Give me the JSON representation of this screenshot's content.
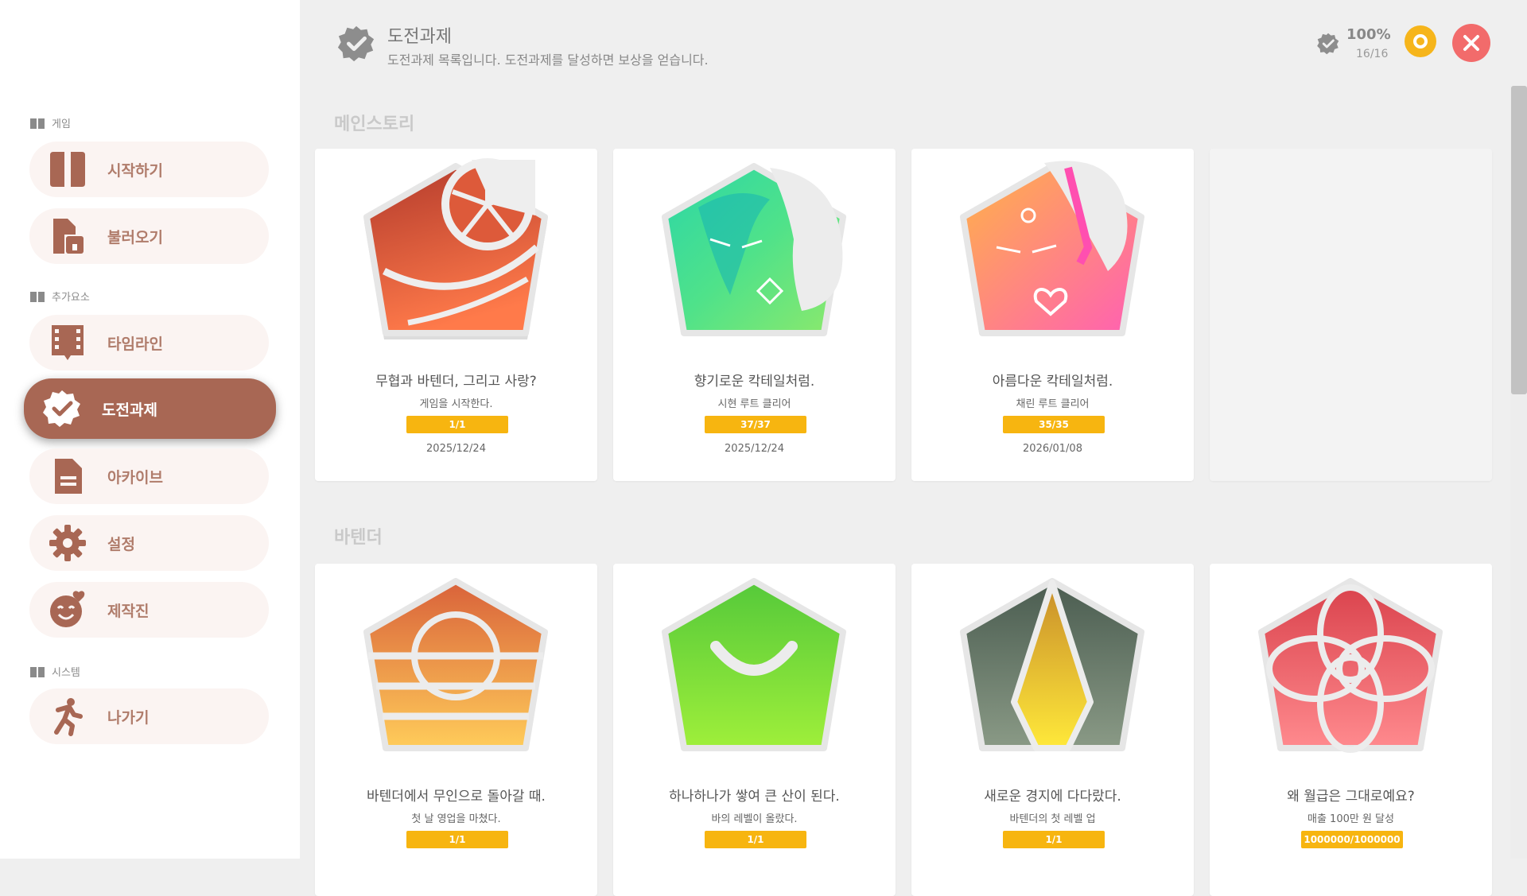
{
  "sidebar": {
    "sections": [
      {
        "label": "게임"
      },
      {
        "label": "추가요소"
      },
      {
        "label": "시스템"
      }
    ],
    "items": [
      {
        "label": "시작하기",
        "icon": "book-icon"
      },
      {
        "label": "불러오기",
        "icon": "load-file-icon"
      },
      {
        "label": "타임라인",
        "icon": "film-icon"
      },
      {
        "label": "도전과제",
        "icon": "badge-check-icon",
        "active": true
      },
      {
        "label": "아카이브",
        "icon": "document-icon"
      },
      {
        "label": "설정",
        "icon": "gear-icon"
      },
      {
        "label": "제작진",
        "icon": "face-heart-icon"
      },
      {
        "label": "나가기",
        "icon": "running-person-icon"
      }
    ]
  },
  "header": {
    "title": "도전과제",
    "subtitle": "도전과제 목록입니다. 도전과제를 달성하면 보상을 얻습니다.",
    "percent": "100%",
    "count": "16/16"
  },
  "groups": [
    {
      "title": "메인스토리",
      "cards": [
        {
          "title": "무협과 바텐더, 그리고 사랑?",
          "desc": "게임을 시작한다.",
          "progress": "1/1",
          "date": "2025/12/24"
        },
        {
          "title": "향기로운 칵테일처럼.",
          "desc": "시현 루트 클리어",
          "progress": "37/37",
          "date": "2025/12/24"
        },
        {
          "title": "아름다운 칵테일처럼.",
          "desc": "채린 루트 클리어",
          "progress": "35/35",
          "date": "2026/01/08"
        }
      ]
    },
    {
      "title": "바텐더",
      "cards": [
        {
          "title": "바텐더에서 무인으로 돌아갈 때.",
          "desc": "첫 날 영업을 마쳤다.",
          "progress": "1/1"
        },
        {
          "title": "하나하나가 쌓여 큰 산이 된다.",
          "desc": "바의 레벨이 올랐다.",
          "progress": "1/1"
        },
        {
          "title": "새로운 경지에 다다랐다.",
          "desc": "바텐더의 첫 레벨 업",
          "progress": "1/1"
        },
        {
          "title": "왜 월급은 그대로예요?",
          "desc": "매출 100만 원 달성",
          "progress": "1000000/1000000"
        }
      ]
    }
  ],
  "colors": {
    "accent": "#a86754",
    "progress": "#f7b510",
    "close": "#f26b6b",
    "coin": "#f6b51b"
  }
}
